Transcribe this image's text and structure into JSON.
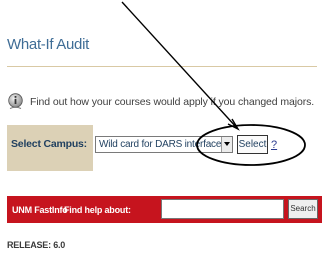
{
  "page": {
    "title": "What-If Audit",
    "info_text": "Find out how your courses would apply if you changed majors.",
    "info_icon": "info-icon"
  },
  "campus": {
    "label": "Select Campus:",
    "selected_option": "Wild card for DARS interface",
    "select_button": "Select",
    "help_link": "?"
  },
  "fastinfo": {
    "brand": "UNM FastInfo",
    "find_label": "Find help about:",
    "search_value": "",
    "search_button": "Search",
    "bar_color": "#c6141e"
  },
  "footer": {
    "release": "RELEASE: 6.0"
  },
  "colors": {
    "title": "#3f6d96",
    "campus_bg": "#dcd1b6",
    "annotation": "#000000"
  }
}
